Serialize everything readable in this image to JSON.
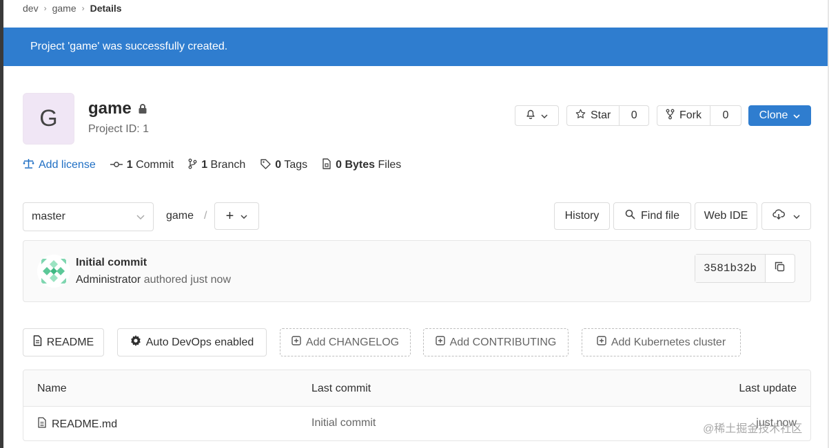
{
  "breadcrumb": [
    "dev",
    "game",
    "Details"
  ],
  "flash": {
    "message": "Project 'game' was successfully created."
  },
  "project": {
    "avatar_letter": "G",
    "name": "game",
    "id_label": "Project ID: 1",
    "avatar_color": "#f0e6f5"
  },
  "header_buttons": {
    "star_label": "Star",
    "star_count": "0",
    "fork_label": "Fork",
    "fork_count": "0",
    "clone_label": "Clone"
  },
  "stats": {
    "add_license": "Add license",
    "commits_num": "1",
    "commits_label": "Commit",
    "branches_num": "1",
    "branches_label": "Branch",
    "tags_num": "0",
    "tags_label": "Tags",
    "files_num": "0 Bytes",
    "files_label": "Files"
  },
  "repo_toolbar": {
    "branch": "master",
    "path": "game",
    "path_sep": "/",
    "add_symbol": "+",
    "history": "History",
    "find_file": "Find file",
    "web_ide": "Web IDE"
  },
  "last_commit": {
    "title": "Initial commit",
    "author": "Administrator",
    "meta": "authored just now",
    "sha": "3581b32b"
  },
  "quick_actions": {
    "readme": "README",
    "auto_devops": "Auto DevOps enabled",
    "add_changelog": "Add CHANGELOG",
    "add_contributing": "Add CONTRIBUTING",
    "add_kubernetes": "Add Kubernetes cluster"
  },
  "file_table": {
    "headers": {
      "name": "Name",
      "last_commit": "Last commit",
      "last_update": "Last update"
    },
    "rows": [
      {
        "name": "README.md",
        "last_commit": "Initial commit",
        "last_update": "just now"
      }
    ]
  },
  "watermark": "@稀土掘金技术社区",
  "colors": {
    "primary": "#2f7dcf",
    "link": "#1f6fc4"
  }
}
